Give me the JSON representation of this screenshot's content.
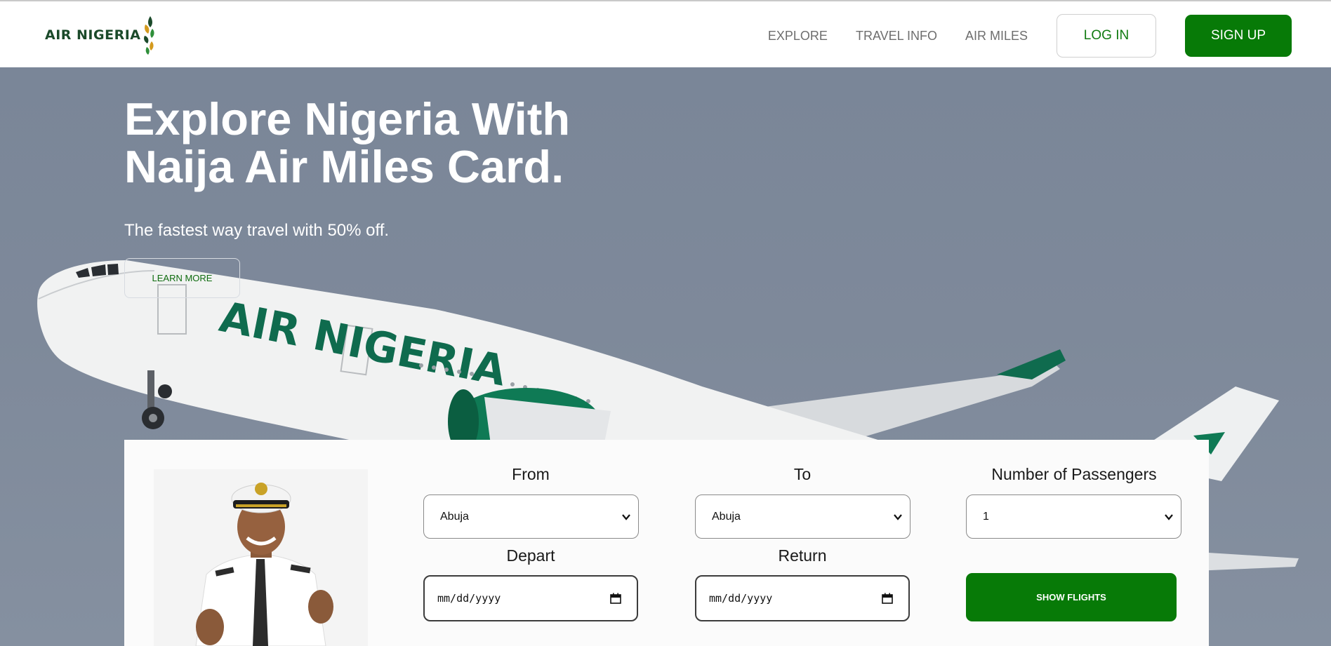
{
  "brand": {
    "name": "AIR NIGERIA",
    "accent": "#077a07",
    "dark_green": "#1b4a2a"
  },
  "nav": {
    "links": [
      "EXPLORE",
      "TRAVEL INFO",
      "AIR MILES"
    ],
    "login_label": "LOG IN",
    "signup_label": "SIGN UP"
  },
  "hero": {
    "title_line1": "Explore Nigeria With",
    "title_line2": "Naija Air Miles Card.",
    "subtitle": "The fastest way travel with 50% off.",
    "cta_label": "LEARN MORE",
    "plane_livery": "AIR NIGERIA"
  },
  "booking": {
    "from": {
      "label": "From",
      "value": "Abuja"
    },
    "to": {
      "label": "To",
      "value": "Abuja"
    },
    "passengers": {
      "label": "Number of Passengers",
      "value": "1"
    },
    "depart": {
      "label": "Depart",
      "placeholder": "mm/dd/yyyy"
    },
    "return": {
      "label": "Return",
      "placeholder": "mm/dd/yyyy"
    },
    "submit_label": "SHOW FLIGHTS"
  },
  "icons": [
    "logo-leaf-icon",
    "chevron-down-icon",
    "calendar-icon"
  ]
}
